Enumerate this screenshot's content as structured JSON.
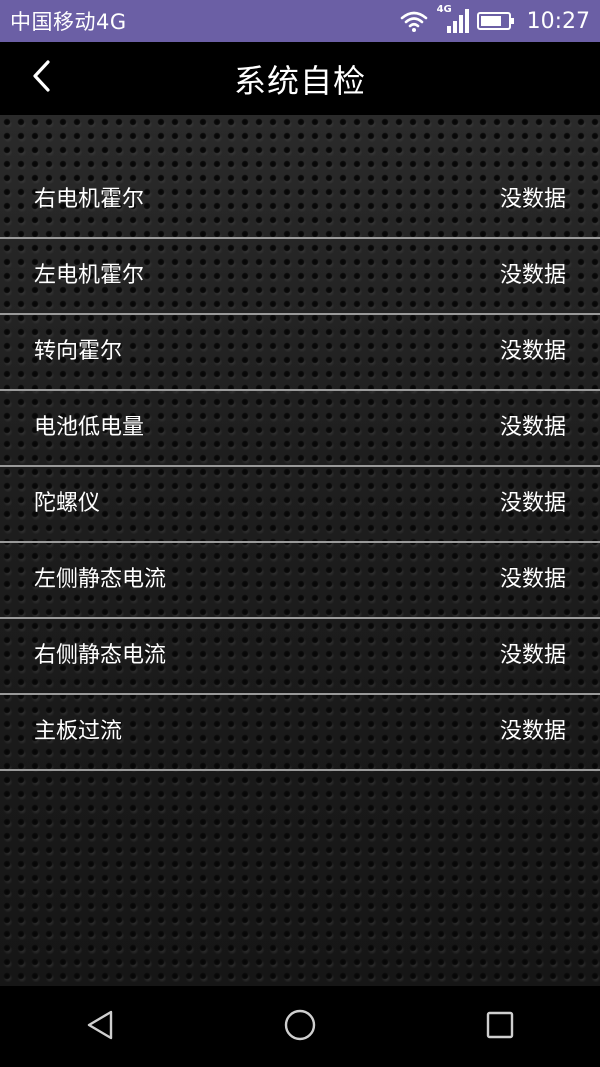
{
  "status_bar": {
    "carrier": "中国移动4G",
    "network_badge": "4G",
    "time": "10:27",
    "icons": [
      "wifi-icon",
      "signal-icon",
      "battery-icon"
    ]
  },
  "header": {
    "title": "系统自检",
    "back_icon": "chevron-left-icon"
  },
  "checks": [
    {
      "name": "右电机霍尔",
      "value": "没数据"
    },
    {
      "name": "左电机霍尔",
      "value": "没数据"
    },
    {
      "name": "转向霍尔",
      "value": "没数据"
    },
    {
      "name": "电池低电量",
      "value": "没数据"
    },
    {
      "name": "陀螺仪",
      "value": "没数据"
    },
    {
      "name": "左侧静态电流",
      "value": "没数据"
    },
    {
      "name": "右侧静态电流",
      "value": "没数据"
    },
    {
      "name": "主板过流",
      "value": "没数据"
    }
  ],
  "nav_bar": {
    "icons": [
      "back-triangle-icon",
      "home-circle-icon",
      "recents-square-icon"
    ]
  },
  "colors": {
    "status_bar_bg": "#6b5fa5",
    "header_bg": "#000000",
    "text": "#ffffff",
    "divider": "#9a9a9a"
  }
}
